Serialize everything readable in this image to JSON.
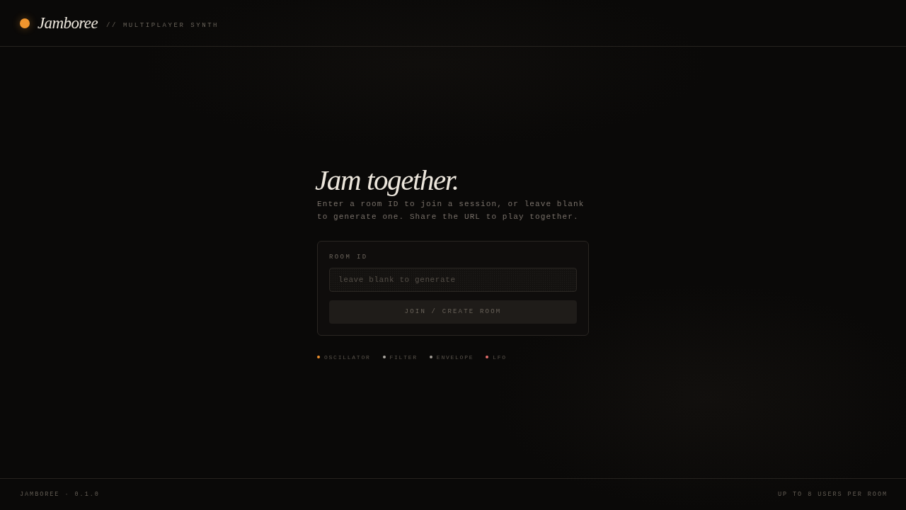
{
  "header": {
    "logo_text": "Jamboree",
    "tagline": "// MULTIPLAYER SYNTH"
  },
  "hero": {
    "title": "Jam together.",
    "description": "Enter a room ID to join a session, or leave blank to generate one. Share the URL to play together."
  },
  "join_form": {
    "field_label": "ROOM ID",
    "room_id": {
      "placeholder": "leave blank to generate"
    },
    "button": {
      "label": "JOIN / CREATE ROOM",
      "disabled": true
    }
  },
  "modules": [
    {
      "label": "OSCILLATOR",
      "color": "#ee8f2c"
    },
    {
      "label": "FILTER",
      "color": "#aca8a1"
    },
    {
      "label": "ENVELOPE",
      "color": "#a29d96"
    },
    {
      "label": "LFO",
      "color": "#e46e6c"
    }
  ],
  "footer": {
    "version": "JAMBOREE · 0.1.0",
    "capacity": "UP TO 8 USERS PER ROOM"
  }
}
